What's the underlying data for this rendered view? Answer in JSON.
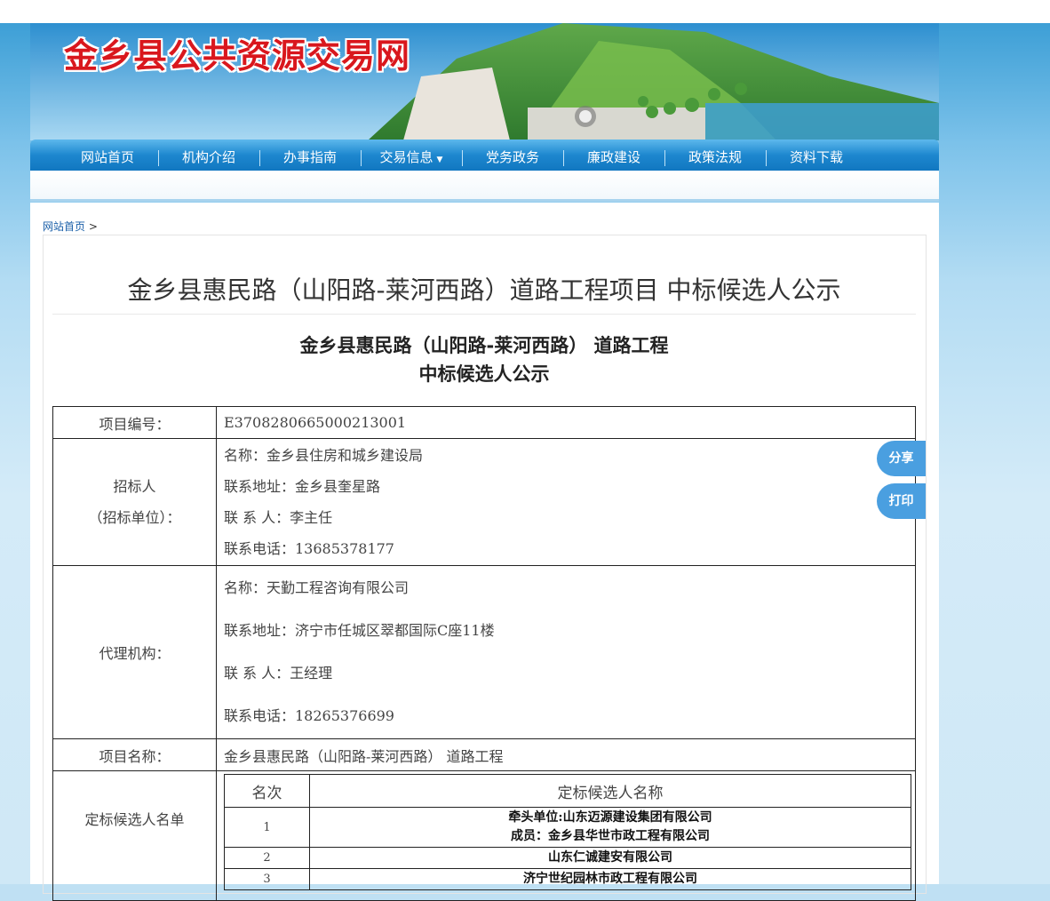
{
  "site": {
    "title": "金乡县公共资源交易网"
  },
  "nav": {
    "items": [
      {
        "label": "网站首页"
      },
      {
        "label": "机构介绍"
      },
      {
        "label": "办事指南"
      },
      {
        "label": "交易信息",
        "caret": "▼"
      },
      {
        "label": "党务政务"
      },
      {
        "label": "廉政建设"
      },
      {
        "label": "政策法规"
      },
      {
        "label": "资料下载"
      }
    ]
  },
  "breadcrumb": {
    "home": "网站首页",
    "sep": ">"
  },
  "article": {
    "title": "金乡县惠民路（山阳路-莱河西路）道路工程项目 中标候选人公示",
    "subtitle_line1": "金乡县惠民路（山阳路-莱河西路） 道路工程",
    "subtitle_line2": "中标候选人公示"
  },
  "info": {
    "project_no_label": "项目编号：",
    "project_no": "E3708280665000213001",
    "tenderer_label_1": "招标人",
    "tenderer_label_2": "（招标单位）：",
    "tenderer": {
      "name": "名称：金乡县住房和城乡建设局",
      "address": "联系地址：金乡县奎星路",
      "contact": "联 系 人：李主任",
      "phone": "联系电话：13685378177"
    },
    "agency_label": "代理机构：",
    "agency": {
      "name": "名称：天勤工程咨询有限公司",
      "address": "联系地址：济宁市任城区翠都国际C座11楼",
      "contact": "联 系 人：王经理",
      "phone": "联系电话：18265376699"
    },
    "project_name_label": "项目名称：",
    "project_name": "金乡县惠民路（山阳路-莱河西路） 道路工程",
    "candidates_label": "定标候选人名单",
    "candidates": {
      "col_rank": "名次",
      "col_name": "定标候选人名称",
      "rows": [
        {
          "rank": "1",
          "line1": "牵头单位:山东迈源建设集团有限公司",
          "line2": "成员：金乡县华世市政工程有限公司"
        },
        {
          "rank": "2",
          "line1": "山东仁诚建安有限公司"
        },
        {
          "rank": "3",
          "line1": "济宁世纪园林市政工程有限公司"
        }
      ]
    }
  },
  "float": {
    "share": "分享",
    "print": "打印"
  }
}
